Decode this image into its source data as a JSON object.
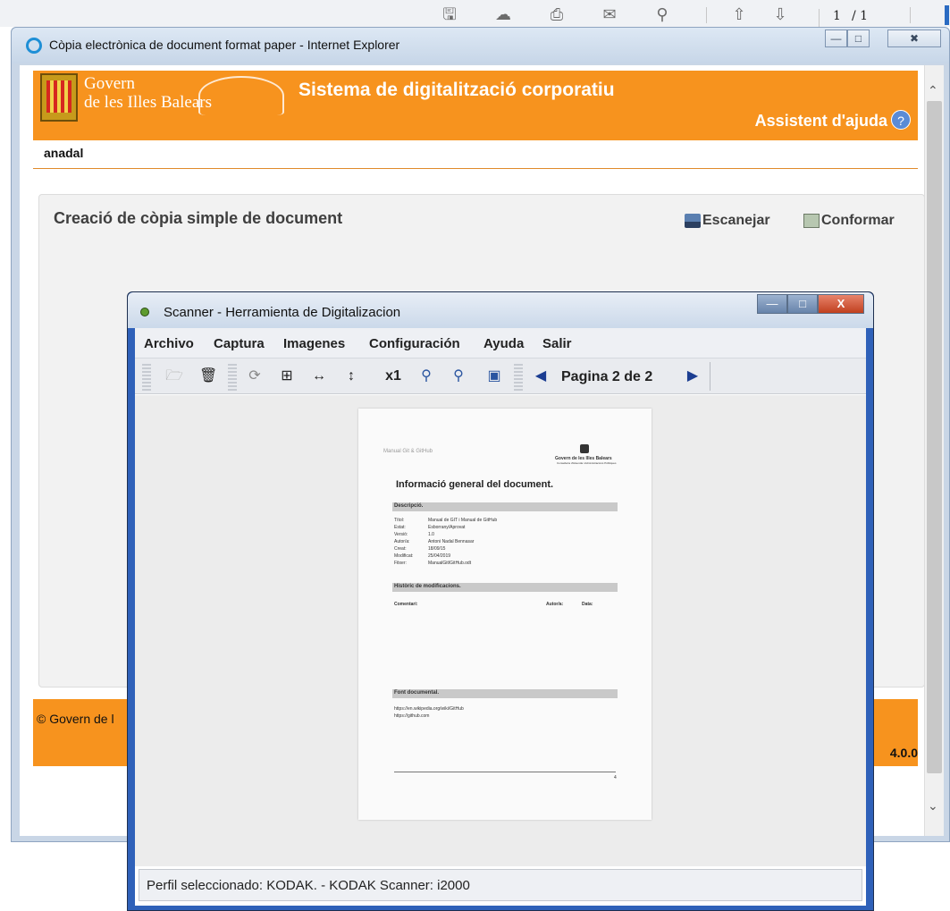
{
  "pdf_toolbar": {
    "icons": [
      "save-icon",
      "upload-icon",
      "print-icon",
      "mail-icon",
      "search-icon",
      "arrow-up-icon",
      "arrow-down-icon"
    ],
    "page_current": "1",
    "page_total": "/ 1"
  },
  "ie_window": {
    "title": "Còpia electrònica de document format paper - Internet Explorer",
    "header": {
      "brand_line1": "Govern",
      "brand_line2": "de les Illes Balears",
      "system_title": "Sistema de digitalització corporatiu",
      "help_label": "Assistent d'ajuda",
      "help_icon": "?"
    },
    "username": "anadal",
    "panel": {
      "title": "Creació de còpia simple de document",
      "actions": {
        "scan_label": "Escanejar",
        "conform_label": "Conformar"
      }
    },
    "footer": {
      "copyright": "© Govern de l",
      "version": "4.0.0"
    }
  },
  "scanner_window": {
    "title": "Scanner - Herramienta de Digitalizacion",
    "menu": [
      "Archivo",
      "Captura",
      "Imagenes",
      "Configuración",
      "Ayuda",
      "Salir"
    ],
    "toolbar_icons": [
      "open-icon",
      "trash-icon",
      "rotate-icon",
      "fit-page-icon",
      "fit-width-icon",
      "fit-height-icon",
      "zoom-1x-icon",
      "zoom-in-icon",
      "zoom-out-icon",
      "select-area-icon",
      "prev-page-icon",
      "next-page-icon"
    ],
    "zoom_label": "x1",
    "page_indicator": "Pagina 2 de 2",
    "status": "Perfil seleccionado: KODAK. - KODAK Scanner: i2000",
    "scanned_page": {
      "header_left": "Manual Git & GitHub",
      "header_right_1": "Govern de les Illes Balears",
      "header_right_2": "Conselleria d'Hisenda i Administracions Públiques",
      "heading": "Informació general del document.",
      "section_description": "Descripció.",
      "fields": [
        {
          "k": "Títol:",
          "v": "Manual de GIT i Manual de GitHub"
        },
        {
          "k": "Estat:",
          "v": "Esborrany/Aprovat"
        },
        {
          "k": "Versió:",
          "v": "1.0"
        },
        {
          "k": "Autor/a:",
          "v": "Antoni Nadal Bennasar"
        },
        {
          "k": "Creat:",
          "v": "18/09/15"
        },
        {
          "k": "Modificat:",
          "v": "25/04/2019"
        },
        {
          "k": "Fitxer:",
          "v": "ManualGitIGitHub.odt"
        }
      ],
      "section_history": "Històric de modificacions.",
      "history_cols": [
        "Comentari:",
        "Autor/a:",
        "Data:"
      ],
      "section_sources": "Font documental.",
      "links": [
        "https://en.wikipedia.org/wiki/GitHub",
        "https://github.com"
      ],
      "page_number": "4"
    }
  }
}
